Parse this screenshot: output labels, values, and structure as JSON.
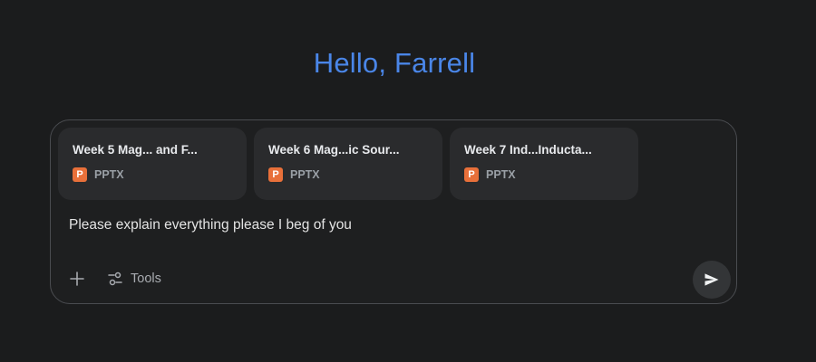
{
  "greeting": "Hello, Farrell",
  "attachments": [
    {
      "name": "Week 5 Mag... and F...",
      "type": "PPTX",
      "icon": "powerpoint-file-icon",
      "icon_letter": "P"
    },
    {
      "name": "Week 6 Mag...ic Sour...",
      "type": "PPTX",
      "icon": "powerpoint-file-icon",
      "icon_letter": "P"
    },
    {
      "name": "Week 7 Ind...Inducta...",
      "type": "PPTX",
      "icon": "powerpoint-file-icon",
      "icon_letter": "P"
    }
  ],
  "prompt": {
    "value": "Please explain everything please I beg of you"
  },
  "toolbar": {
    "add_icon": "plus-icon",
    "tools_icon": "tools-sliders-icon",
    "tools_label": "Tools",
    "send_icon": "send-icon"
  },
  "colors": {
    "background": "#1b1c1d",
    "greeting": "#4a86e8",
    "file_icon": "#e8703a"
  }
}
